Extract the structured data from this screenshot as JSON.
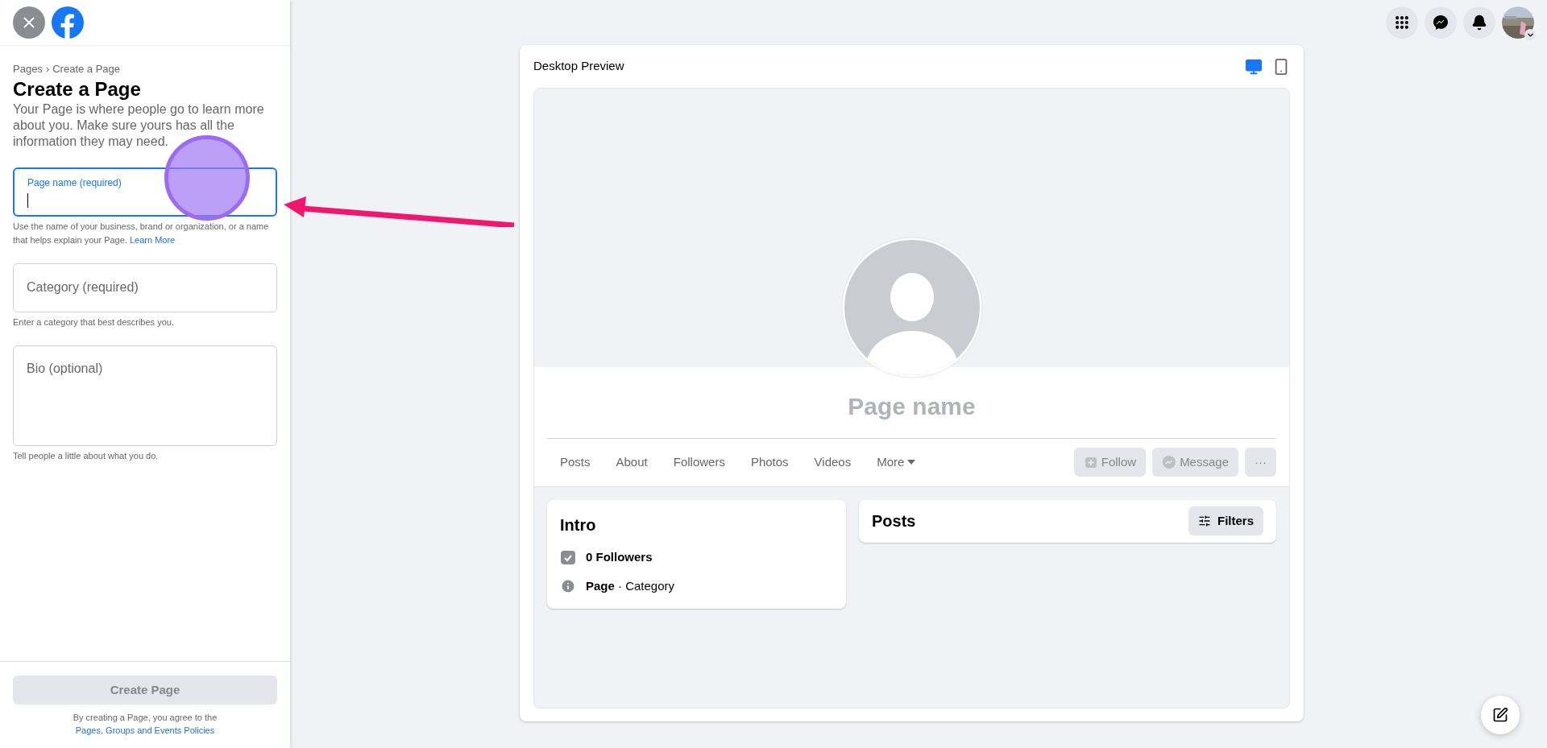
{
  "sidebar": {
    "breadcrumb": [
      "Pages",
      "Create a Page"
    ],
    "breadcrumb_separator": "›",
    "title": "Create a Page",
    "description": "Your Page is where people go to learn more about you. Make sure yours has all the information they may need.",
    "fields": [
      {
        "kind": "input",
        "label": "Page name (required)",
        "focused": true,
        "helper": "Use the name of your business, brand or organization, or a name that helps explain your Page.",
        "link": "Learn More"
      },
      {
        "kind": "input",
        "placeholder": "Category (required)",
        "focused": false,
        "helper": "Enter a category that best describes you."
      },
      {
        "kind": "textarea",
        "placeholder": "Bio (optional)",
        "focused": false,
        "helper": "Tell people a little about what you do."
      }
    ],
    "create_button": {
      "label": "Create Page",
      "disabled": true
    },
    "legal": {
      "text": "By creating a Page, you agree to the",
      "link": "Pages, Groups and Events Policies"
    }
  },
  "preview": {
    "title": "Desktop Preview",
    "view_modes": [
      {
        "kind": "desktop",
        "selected": true
      },
      {
        "kind": "mobile",
        "selected": false
      }
    ],
    "page_name": "Page name",
    "tabs": [
      {
        "label": "Posts",
        "kind": "plain"
      },
      {
        "label": "About",
        "kind": "plain"
      },
      {
        "label": "Followers",
        "kind": "plain"
      },
      {
        "label": "Photos",
        "kind": "plain"
      },
      {
        "label": "Videos",
        "kind": "plain"
      },
      {
        "label": "More",
        "kind": "menu"
      }
    ],
    "actions": [
      {
        "kind": "follow",
        "label": "Follow",
        "disabled": true
      },
      {
        "kind": "message",
        "label": "Message",
        "disabled": true
      },
      {
        "kind": "more",
        "label": "···",
        "disabled": true
      }
    ],
    "intro": {
      "title": "Intro",
      "items": [
        {
          "kind": "followers",
          "text": "**0 Followers**"
        },
        {
          "kind": "info",
          "text": "**Page** · Category"
        }
      ]
    },
    "posts": {
      "title": "Posts",
      "filter_button": "Filters"
    }
  }
}
